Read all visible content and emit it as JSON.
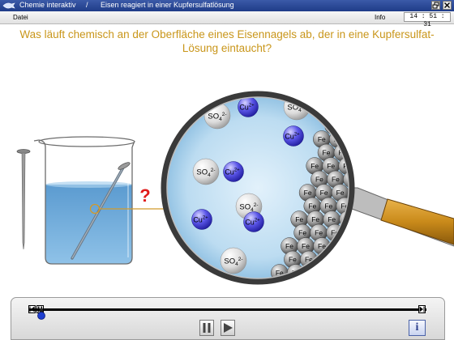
{
  "window": {
    "app_title": "Chemie interaktiv",
    "separator": "/",
    "document_title": "Eisen reagiert in einer Kupfersulfatlösung",
    "buttons": [
      "restore",
      "close"
    ]
  },
  "menu": {
    "file": "Datei",
    "info": "Info",
    "clock": "14 : 51 : 31"
  },
  "question": "Was läuft chemisch an der Oberfläche eines Eisennagels ab, der in eine Kupfersulfat-Lösung eintaucht?",
  "scene": {
    "question_mark": "?",
    "labels": {
      "sulfate_base": "SO",
      "sulfate_sub": "4",
      "sulfate_sup": "2-",
      "copper_base": "Cu",
      "copper_sup": "2+",
      "iron": "Fe"
    }
  },
  "player": {
    "start_label": "skip-to-start",
    "end_label": "skip-to-end",
    "pause_label": "pause",
    "play_label": "play",
    "info_label": "i",
    "progress": 0.03
  },
  "colors": {
    "title_bar": "#1f3c88",
    "question_text": "#c9961a",
    "solution_blue": "#b5d8f0",
    "copper_ion": "#3a36d6",
    "iron_atom": "#8a8a8a",
    "magnifier_handle": "#c98a1a"
  }
}
